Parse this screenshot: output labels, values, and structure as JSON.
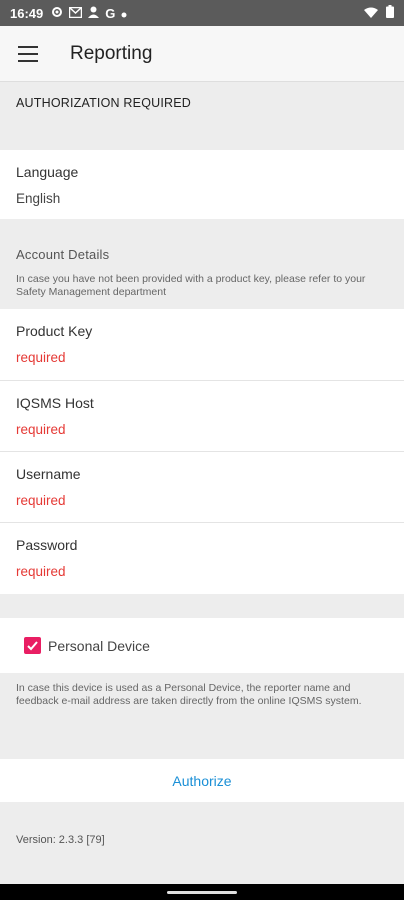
{
  "status_bar": {
    "time": "16:49",
    "left_icons": [
      "settings-icon",
      "mail-icon",
      "person-icon",
      "google-icon",
      "dot-icon"
    ],
    "right_icons": [
      "wifi-icon",
      "battery-icon"
    ]
  },
  "app_bar": {
    "title": "Reporting",
    "menu_icon": "hamburger-menu-icon"
  },
  "authorization": {
    "header": "AUTHORIZATION REQUIRED"
  },
  "language": {
    "label": "Language",
    "value": "English"
  },
  "account": {
    "header": "Account Details",
    "note": "In case you have not been provided with a product key, please refer to your Safety Management department",
    "fields": [
      {
        "label": "Product Key",
        "value": "required"
      },
      {
        "label": "IQSMS Host",
        "value": "required"
      },
      {
        "label": "Username",
        "value": "required"
      },
      {
        "label": "Password",
        "value": "required"
      }
    ]
  },
  "personal_device": {
    "label": "Personal Device",
    "checked": true,
    "note": "In case this device is used as a Personal Device, the reporter name and feedback e-mail address are taken directly from the online IQSMS system."
  },
  "authorize_label": "Authorize",
  "version": "Version: 2.3.3 [79]",
  "colors": {
    "accent": "#e91e63",
    "error": "#e53935",
    "link": "#1a8fd6"
  }
}
